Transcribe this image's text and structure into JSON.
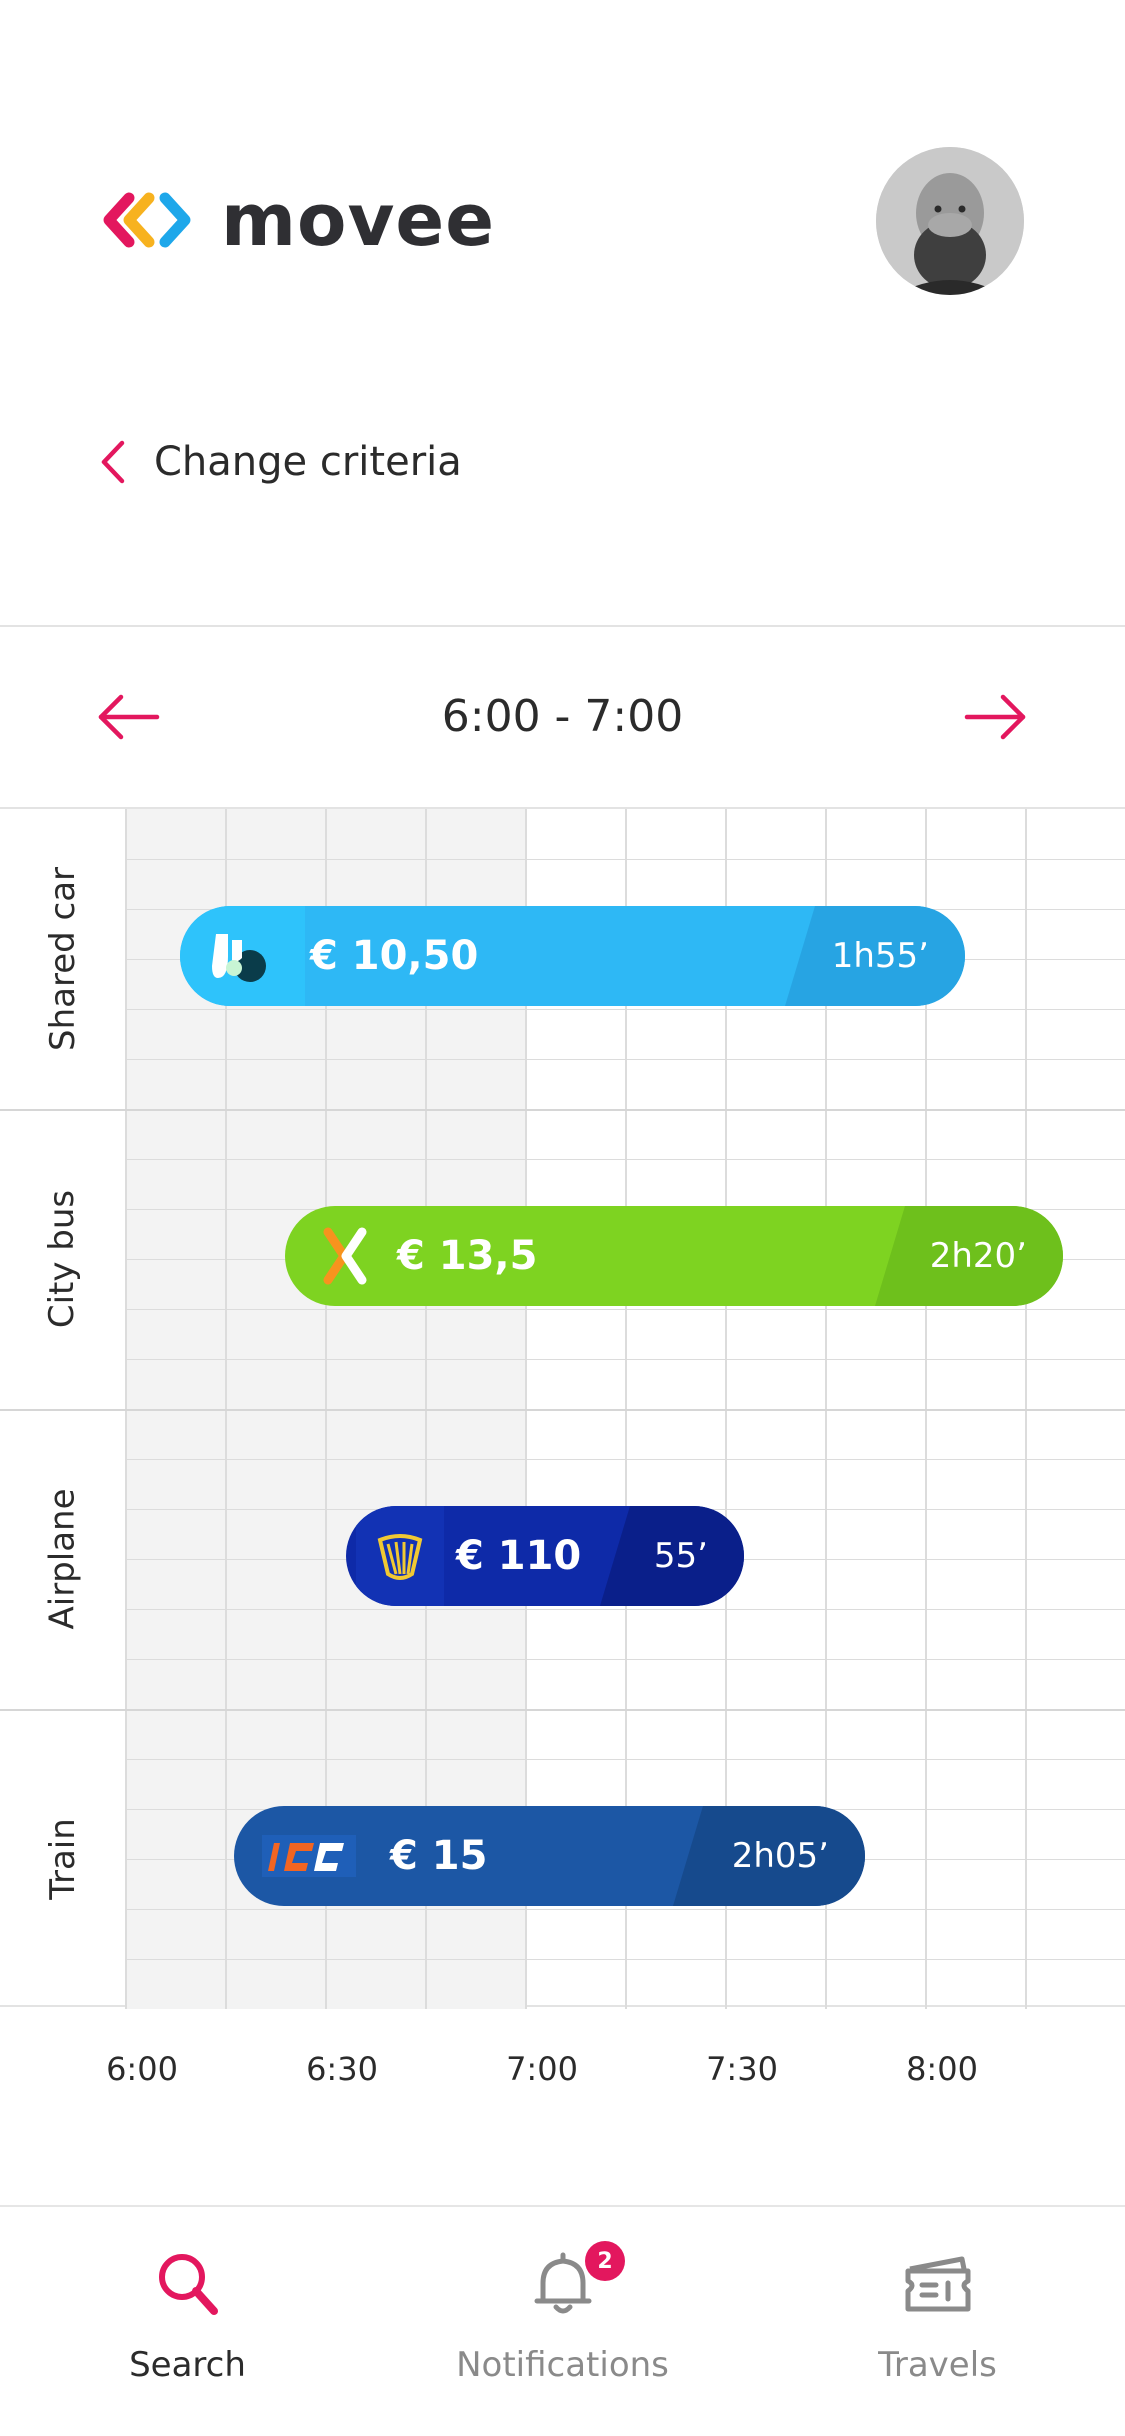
{
  "app": {
    "logo_text": "movee",
    "brand_color": "#e3175e"
  },
  "header": {
    "back_label": "Change criteria"
  },
  "range": {
    "label": "6:00 - 7:00"
  },
  "rows": [
    {
      "label": "Shared car",
      "price": "€ 10,50",
      "duration": "1h55’",
      "color": "#2eb8f5",
      "icon": "blablacar-logo"
    },
    {
      "label": "City bus",
      "price": "€ 13,5",
      "duration": "2h20’",
      "color": "#7ed321",
      "icon": "flixbus-logo"
    },
    {
      "label": "Airplane",
      "price": "€ 110",
      "duration": "55’",
      "color": "#0e2aa8",
      "icon": "ryanair-logo"
    },
    {
      "label": "Train",
      "price": "€ 15",
      "duration": "2h05’",
      "color": "#1c57a5",
      "icon": "intercity-logo"
    }
  ],
  "axis": {
    "ticks": [
      "6:00",
      "6:30",
      "7:00",
      "7:30",
      "8:00"
    ]
  },
  "nav": {
    "items": [
      {
        "label": "Search",
        "icon": "search-icon",
        "active": true
      },
      {
        "label": "Notifications",
        "icon": "bell-icon",
        "badge": "2"
      },
      {
        "label": "Travels",
        "icon": "ticket-icon"
      }
    ]
  }
}
